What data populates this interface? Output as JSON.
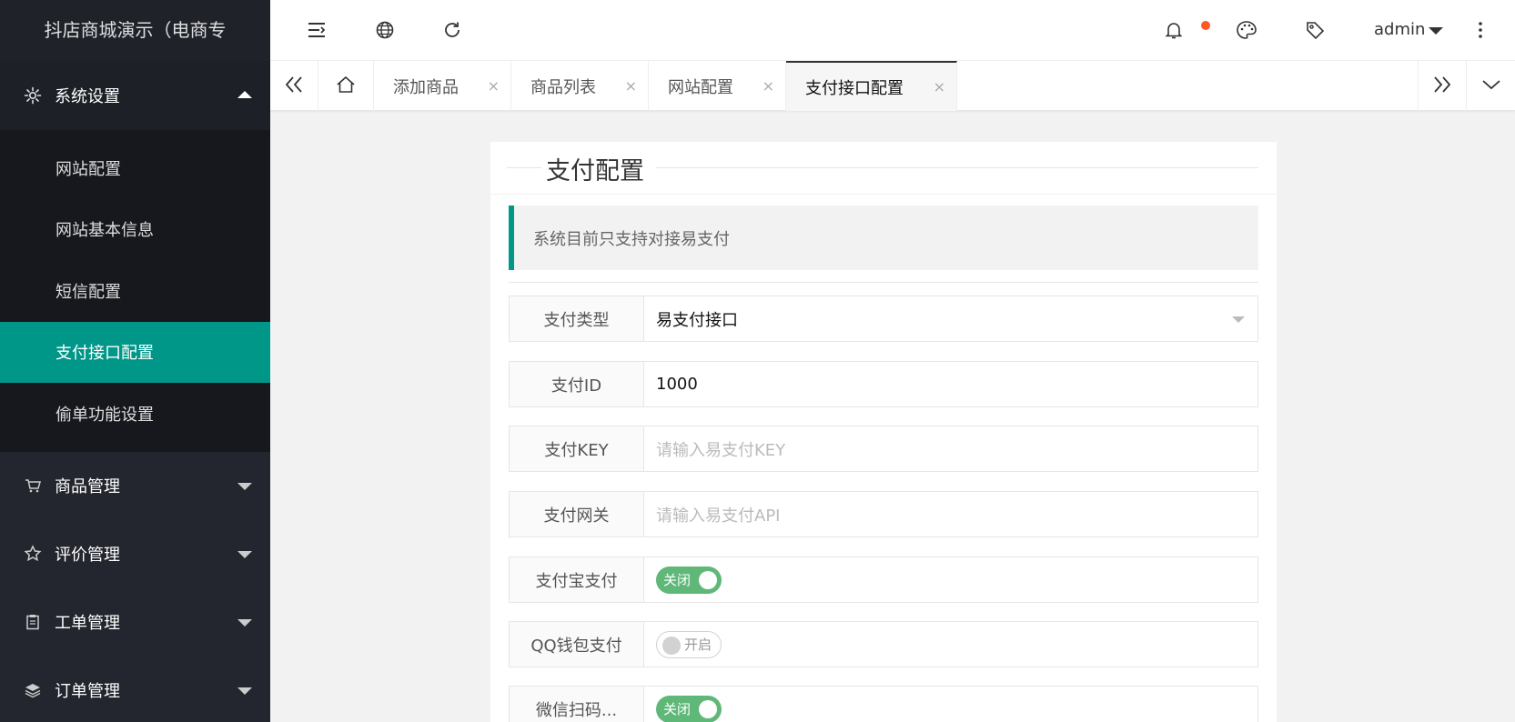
{
  "app": {
    "title": "抖店商城演示（电商专"
  },
  "sidebar": {
    "groups": [
      {
        "label": "系统设置",
        "icon": "gear-icon",
        "expanded": true,
        "items": [
          {
            "label": "网站配置"
          },
          {
            "label": "网站基本信息"
          },
          {
            "label": "短信配置"
          },
          {
            "label": "支付接口配置",
            "active": true
          },
          {
            "label": "偷单功能设置"
          }
        ]
      },
      {
        "label": "商品管理",
        "icon": "cart-icon"
      },
      {
        "label": "评价管理",
        "icon": "star-icon"
      },
      {
        "label": "工单管理",
        "icon": "clipboard-icon"
      },
      {
        "label": "订单管理",
        "icon": "layers-icon"
      }
    ]
  },
  "header": {
    "user": "admin"
  },
  "tabs": {
    "items": [
      {
        "label": "添加商品",
        "close": "×"
      },
      {
        "label": "商品列表",
        "close": "×"
      },
      {
        "label": "网站配置",
        "close": "×"
      },
      {
        "label": "支付接口配置",
        "close": "×",
        "active": true
      }
    ]
  },
  "form": {
    "legend": "支付配置",
    "notice": "系统目前只支持对接易支付",
    "pay_type": {
      "label": "支付类型",
      "value": "易支付接口"
    },
    "pay_id": {
      "label": "支付ID",
      "value": "1000"
    },
    "pay_key": {
      "label": "支付KEY",
      "placeholder": "请输入易支付KEY"
    },
    "pay_gateway": {
      "label": "支付网关",
      "placeholder": "请输入易支付API"
    },
    "alipay": {
      "label": "支付宝支付",
      "switch_text": "关闭",
      "on": true
    },
    "qqpay": {
      "label": "QQ钱包支付",
      "switch_text": "开启",
      "on": false
    },
    "wxpay": {
      "label": "微信扫码...",
      "switch_text": "关闭",
      "on": true
    }
  },
  "colors": {
    "accent": "#009688",
    "sidebar_bg": "#23262e",
    "switch_on": "#5fb878",
    "badge": "#ff5722"
  }
}
